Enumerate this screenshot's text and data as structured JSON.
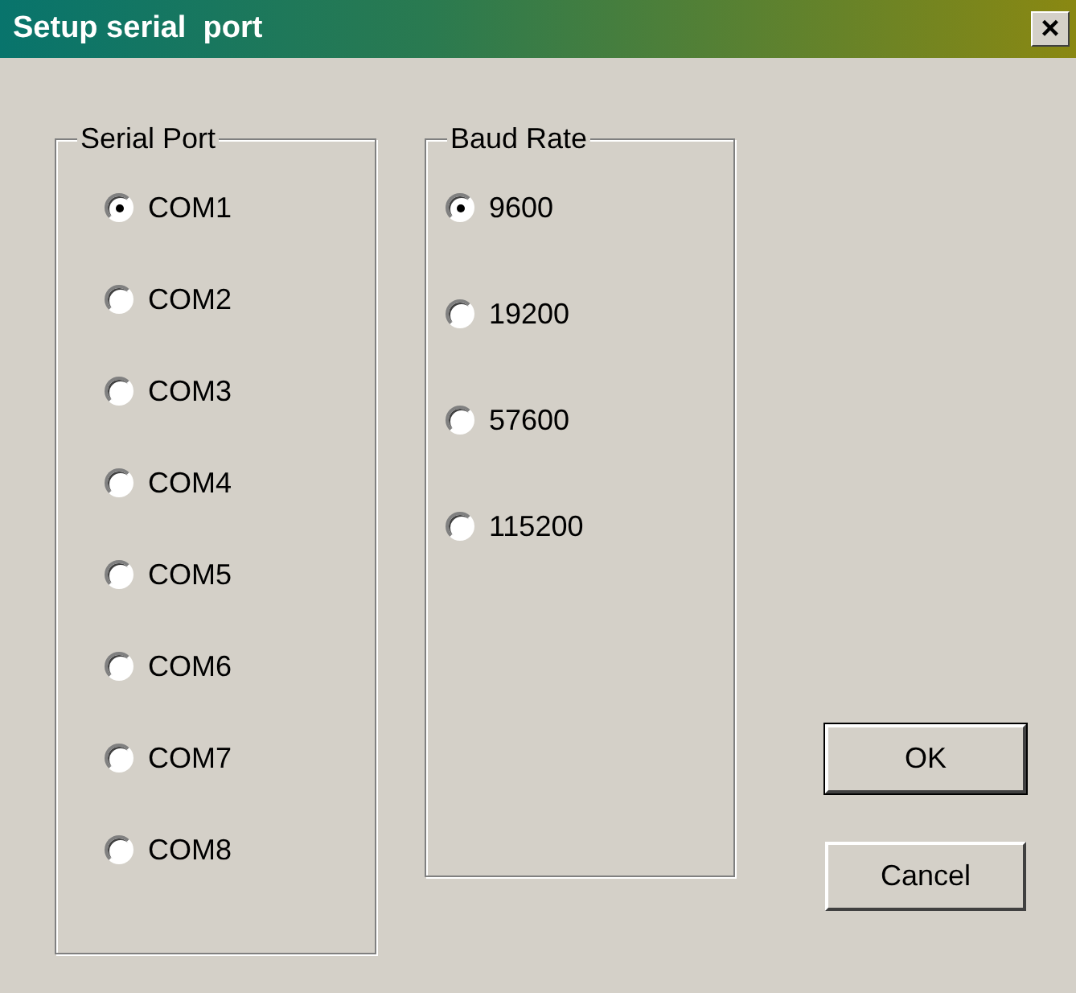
{
  "window": {
    "title": "Setup serial  port",
    "close": "×"
  },
  "serial_port": {
    "label": "Serial Port",
    "options": [
      {
        "label": "COM1",
        "selected": true
      },
      {
        "label": "COM2",
        "selected": false
      },
      {
        "label": "COM3",
        "selected": false
      },
      {
        "label": "COM4",
        "selected": false
      },
      {
        "label": "COM5",
        "selected": false
      },
      {
        "label": "COM6",
        "selected": false
      },
      {
        "label": "COM7",
        "selected": false
      },
      {
        "label": "COM8",
        "selected": false
      }
    ]
  },
  "baud_rate": {
    "label": "Baud Rate",
    "options": [
      {
        "label": "9600",
        "selected": true
      },
      {
        "label": "19200",
        "selected": false
      },
      {
        "label": "57600",
        "selected": false
      },
      {
        "label": "115200",
        "selected": false
      }
    ]
  },
  "buttons": [
    {
      "label": "OK",
      "default": true
    },
    {
      "label": "Cancel",
      "default": false
    }
  ]
}
